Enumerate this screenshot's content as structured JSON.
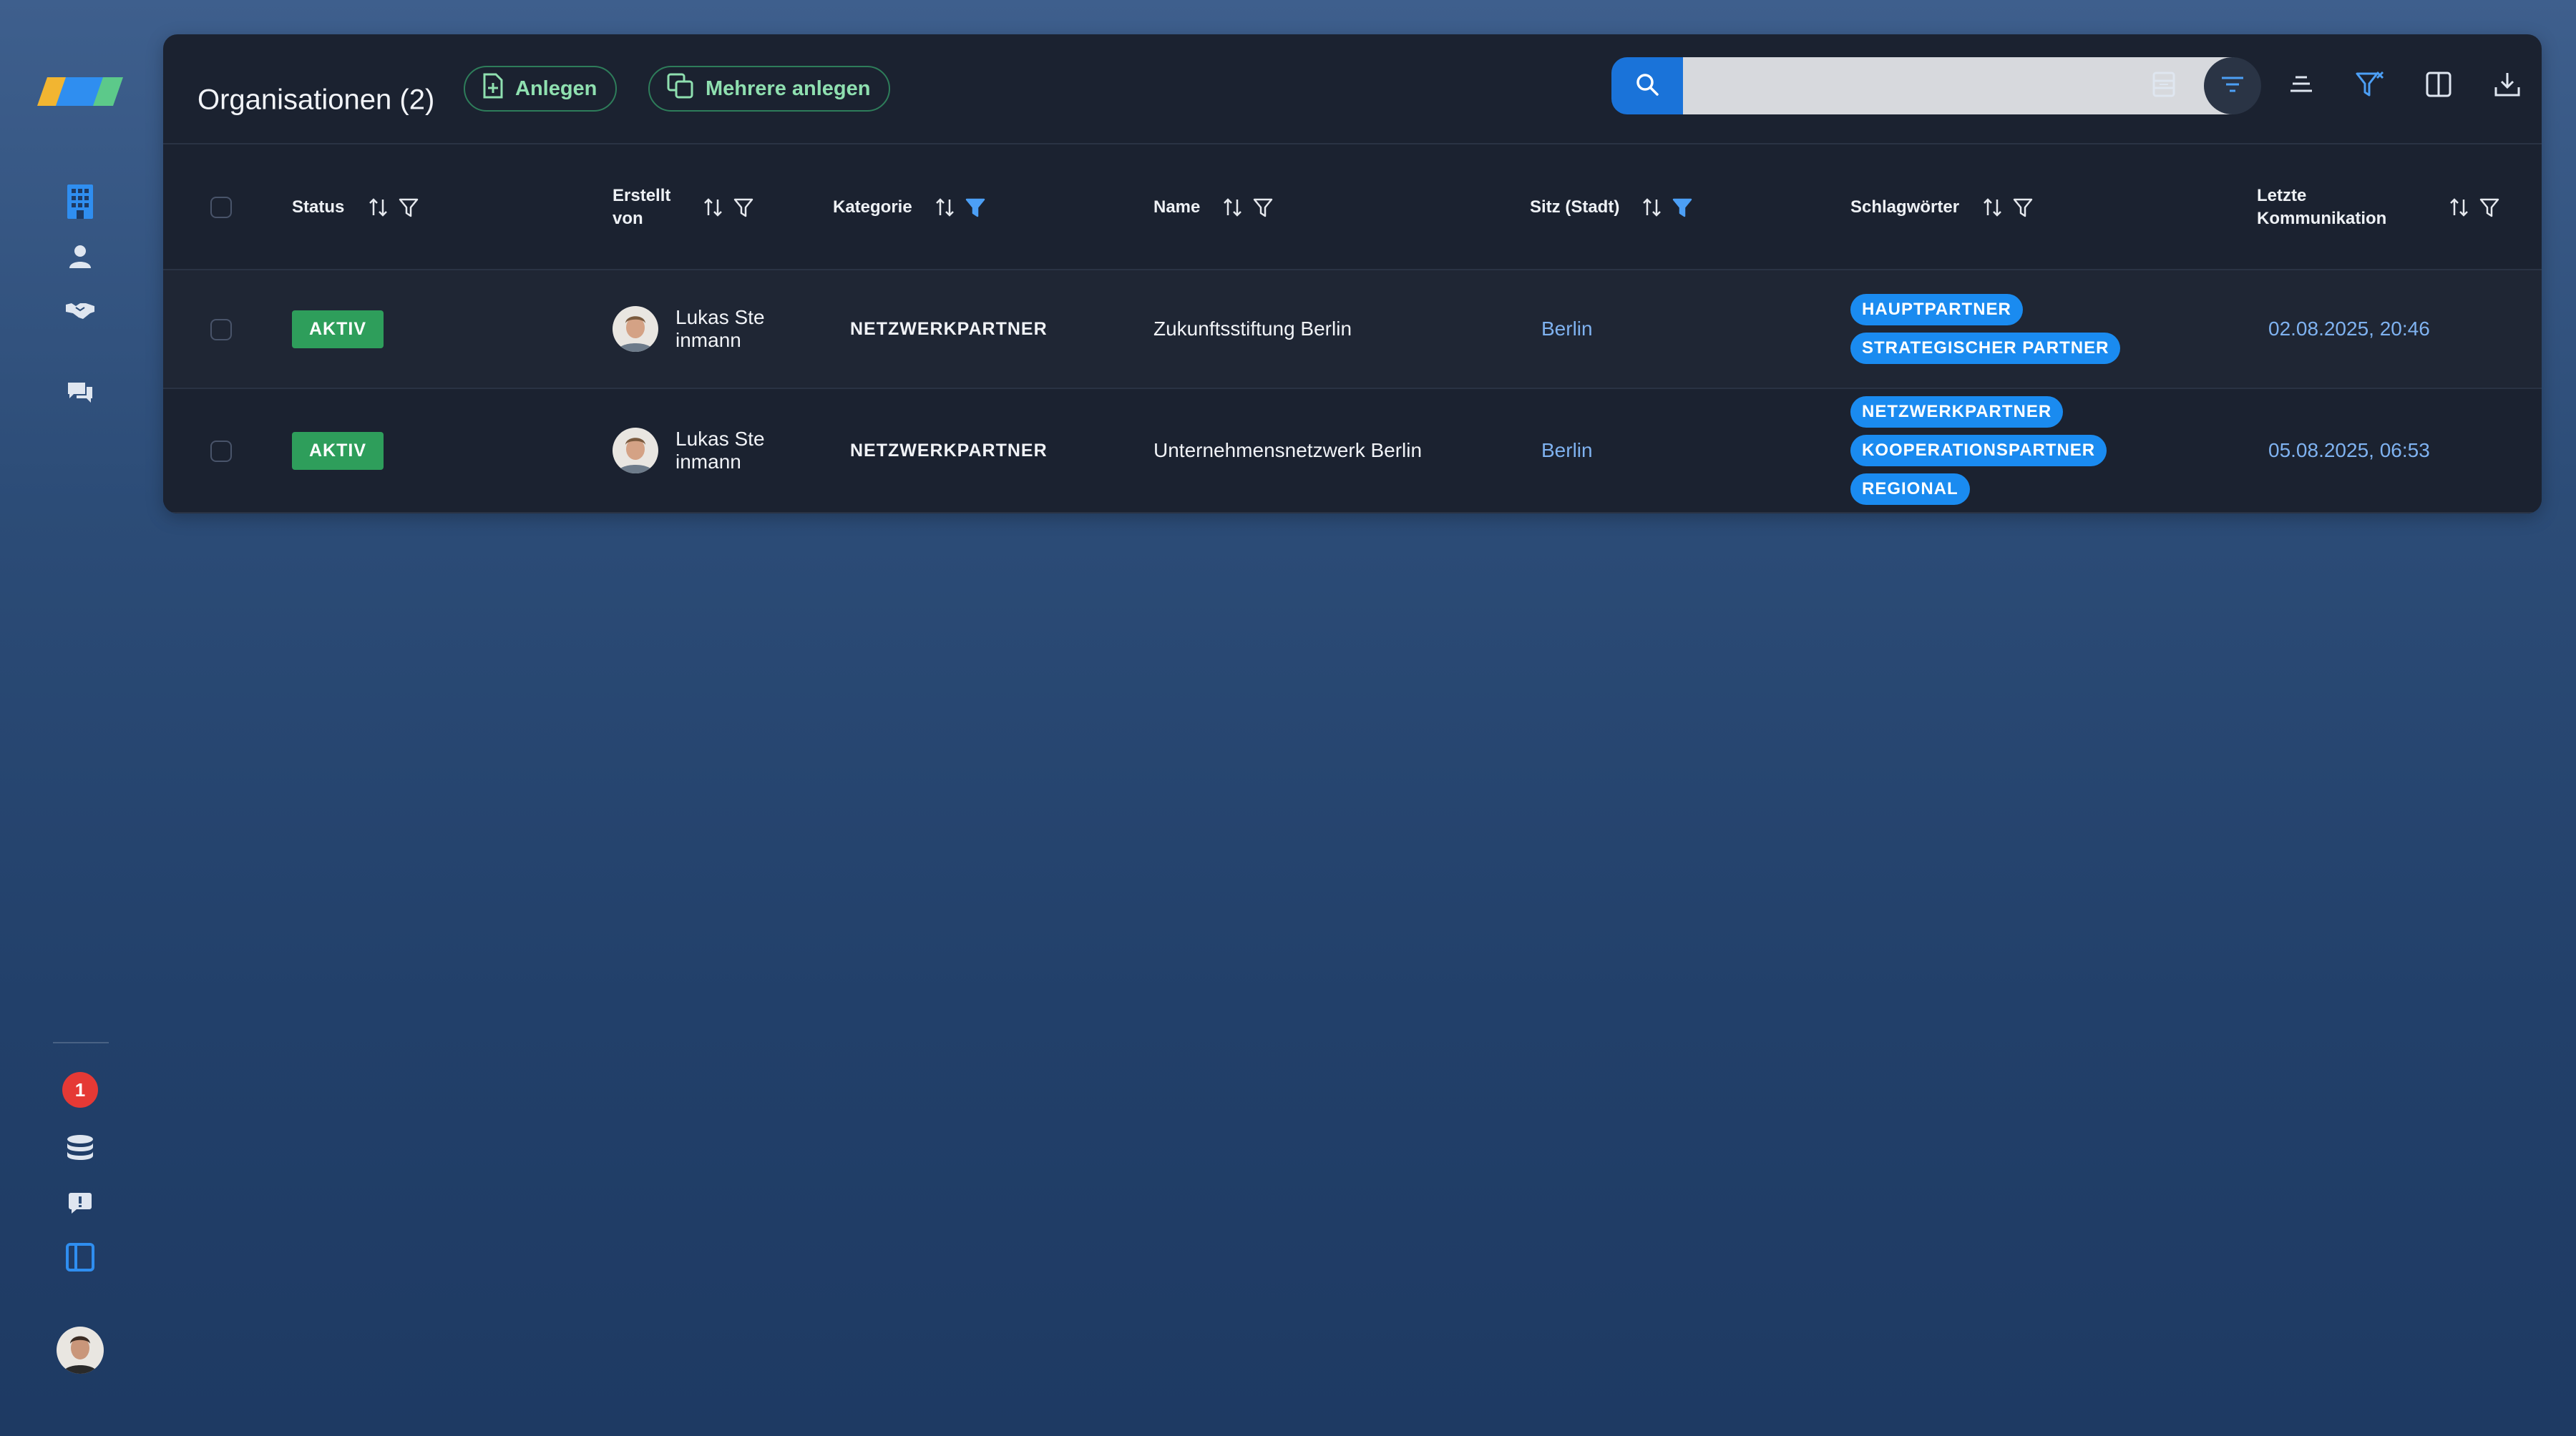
{
  "page": {
    "title": "Organisationen (2)",
    "add_button": "Anlegen",
    "add_multiple_button": "Mehrere anlegen",
    "search_placeholder": ""
  },
  "colors": {
    "accent_blue": "#1a73d9",
    "tag_blue": "#1a8bf0",
    "status_green": "#2e9e5b",
    "link_blue": "#7fb2f0",
    "notification_red": "#e53935"
  },
  "sidebar": {
    "icons": [
      "logo",
      "building-icon",
      "person-icon",
      "handshake-icon",
      "chat-icon",
      "notification-badge",
      "database-icon",
      "feedback-icon",
      "panel-icon",
      "user-avatar"
    ],
    "notification_count": "1"
  },
  "toolbar_icons": [
    "density-icon",
    "filter-lines-icon",
    "align-icon",
    "clear-filter-icon",
    "columns-icon",
    "download-icon"
  ],
  "table": {
    "columns": [
      "Status",
      "Erstellt von",
      "Kategorie",
      "Name",
      "Sitz (Stadt)",
      "Schlagwörter",
      "Letzte Kommunikation"
    ],
    "column_lines": {
      "created_by": [
        "Erstellt",
        "von"
      ],
      "last_comm": [
        "Letzte",
        "Kommunikation"
      ]
    },
    "rows": [
      {
        "status": "AKTIV",
        "created_by": "Lukas Steinmann",
        "category": "NETZWERKPARTNER",
        "name": "Zukunftsstiftung Berlin",
        "city": "Berlin",
        "tags": [
          "HAUPTPARTNER",
          "STRATEGISCHER PARTNER"
        ],
        "last_communication": "02.08.2025, 20:46"
      },
      {
        "status": "AKTIV",
        "created_by": "Lukas Steinmann",
        "category": "NETZWERKPARTNER",
        "name": "Unternehmensnetzwerk Berlin",
        "city": "Berlin",
        "tags": [
          "NETZWERKPARTNER",
          "KOOPERATIONSPARTNER",
          "REGIONAL"
        ],
        "last_communication": "05.08.2025, 06:53"
      }
    ]
  }
}
